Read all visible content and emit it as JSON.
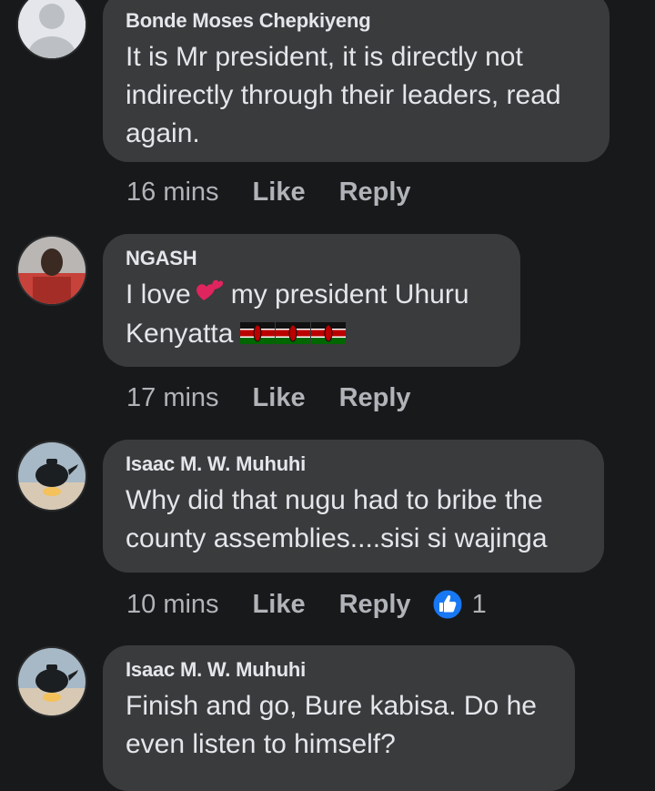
{
  "comments": [
    {
      "author": "Bonde Moses Chepkiyeng",
      "lines": [
        "It is Mr president, it is directly not",
        "indirectly through their leaders, read",
        "again."
      ],
      "time": "16 mins",
      "like_label": "Like",
      "reply_label": "Reply"
    },
    {
      "author": "NGASH",
      "line1_pre": "I love",
      "line1_post": "my president Uhuru",
      "line2": "Kenyatta",
      "emoji_heart": "heart-emoji",
      "emoji_flag": "kenya-flag-emoji",
      "time": "17 mins",
      "like_label": "Like",
      "reply_label": "Reply"
    },
    {
      "author": "Isaac M. W. Muhuhi",
      "lines": [
        "Why did that nugu had to bribe the",
        "county assemblies....sisi si wajinga"
      ],
      "time": "10 mins",
      "like_label": "Like",
      "reply_label": "Reply",
      "reaction_icon": "like-thumb-icon",
      "reaction_count": "1"
    },
    {
      "author": "Isaac M. W. Muhuhi",
      "lines": [
        "Finish and go, Bure kabisa. Do he",
        "even listen to himself?"
      ]
    }
  ],
  "colors": {
    "background": "#18191a",
    "bubble": "#3a3b3c",
    "text": "#e4e6eb",
    "secondary": "#b0b3b8",
    "like_blue": "#1877f2"
  }
}
